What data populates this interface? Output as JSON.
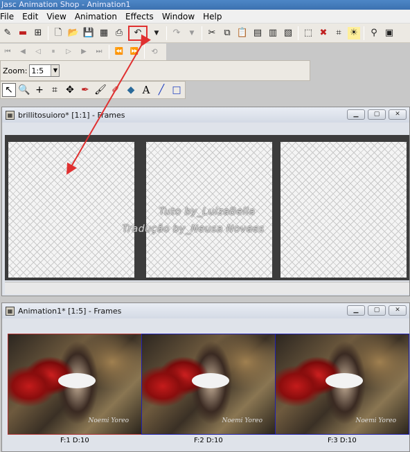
{
  "app": {
    "title": "Jasc Animation Shop - Animation1"
  },
  "menu": [
    "File",
    "Edit",
    "View",
    "Animation",
    "Effects",
    "Window",
    "Help"
  ],
  "zoom": {
    "label": "Zoom:",
    "value": "1:5"
  },
  "window_top": {
    "title": "brillitosuioro* [1:1] - Frames"
  },
  "window_bottom": {
    "title": "Animation1* [1:5] - Frames",
    "frames": [
      {
        "label": "F:1   D:10",
        "signature": "Noemi Yoreo"
      },
      {
        "label": "F:2   D:10",
        "signature": "Noemi Yoreo"
      },
      {
        "label": "F:3   D:10",
        "signature": "Noemi Yoreo"
      }
    ]
  },
  "watermark": {
    "line1": "Tuto by_LuizaBella",
    "line2": "Tradução by_Neusa Novaes"
  },
  "icons": {
    "toolbar1": [
      "new-icon",
      "open-icon",
      "save-icon",
      "save-all-icon",
      "print-icon",
      "undo-icon",
      "undo-dropdown-icon",
      "redo-icon",
      "redo-dropdown-icon",
      "cut-icon",
      "copy-icon",
      "paste-icon",
      "paste-frame-icon",
      "paste-before-icon",
      "paste-after-icon",
      "insert-frames-icon",
      "delete-frames-icon",
      "crop-icon",
      "properties-icon",
      "help-icon"
    ],
    "tools": [
      "select-tool-icon",
      "zoom-tool-icon",
      "move-tool-icon",
      "crop-tool-icon",
      "mover-tool-icon",
      "dropper-tool-icon",
      "brush-tool-icon",
      "clone-tool-icon",
      "fill-tool-icon",
      "text-tool-icon",
      "line-tool-icon",
      "rectangle-tool-icon"
    ]
  },
  "colors": {
    "accent": "#e03030",
    "selection": "#2020b0"
  }
}
